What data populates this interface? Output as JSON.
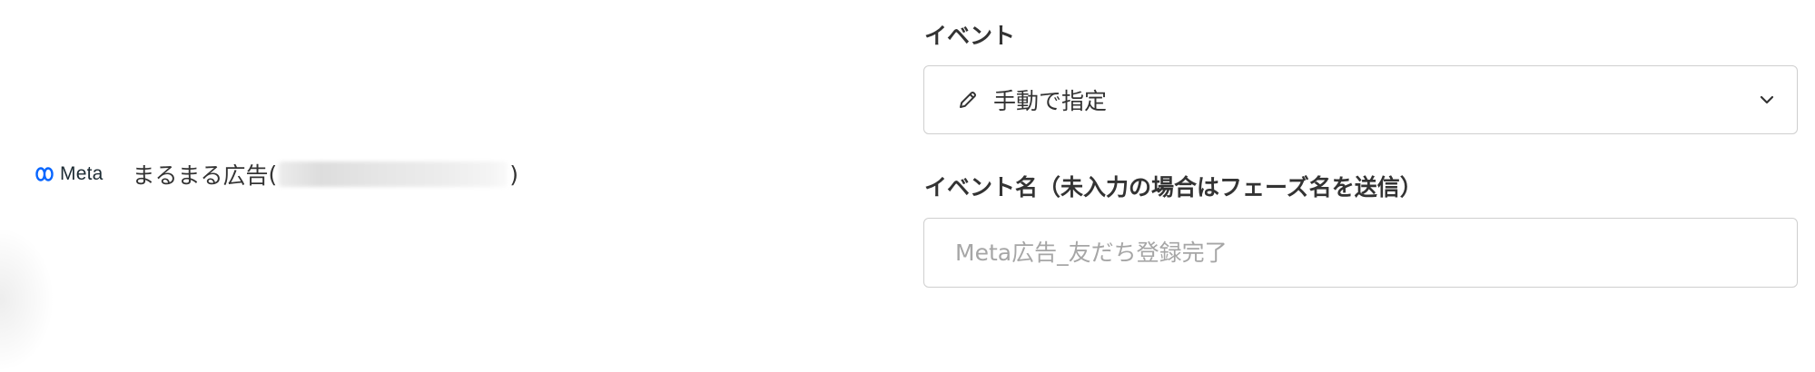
{
  "account": {
    "platform_logo_text": "Meta",
    "name": "まるまる広告",
    "paren_open": "(",
    "paren_close": ")"
  },
  "event": {
    "label": "イベント",
    "selected_value": "手動で指定",
    "icon": "pencil-icon",
    "dropdown_icon": "chevron-down-icon"
  },
  "event_name": {
    "label": "イベント名（未入力の場合はフェーズ名を送信）",
    "value": "",
    "placeholder": "Meta広告_友だち登録完了"
  },
  "colors": {
    "text": "#333333",
    "placeholder": "#a6a6a6",
    "border": "#cfcfcf",
    "meta_blue": "#0866ff"
  }
}
